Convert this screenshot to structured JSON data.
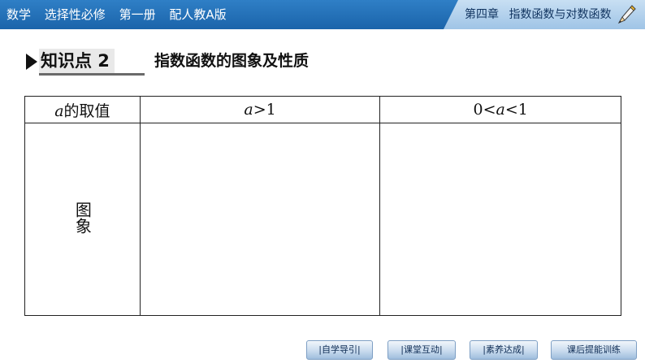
{
  "header": {
    "left_items": [
      "数学",
      "选择性必修",
      "第一册",
      "配人教A版"
    ],
    "chapter": "第四章",
    "chapter_title": "指数函数与对数函数"
  },
  "section": {
    "knowledge_point": "知识点 2",
    "title": "指数函数的图象及性质"
  },
  "table": {
    "header": {
      "col1_var": "a",
      "col1_text": "的取值",
      "col2_var": "a",
      "col2_text": ">1",
      "col3_pre": "0<",
      "col3_var": "a",
      "col3_post": "<1"
    },
    "row_label": "图象"
  },
  "nav": {
    "buttons": [
      "|自学导引|",
      "|课堂互动|",
      "|素养达成|",
      "课后提能训练"
    ]
  }
}
